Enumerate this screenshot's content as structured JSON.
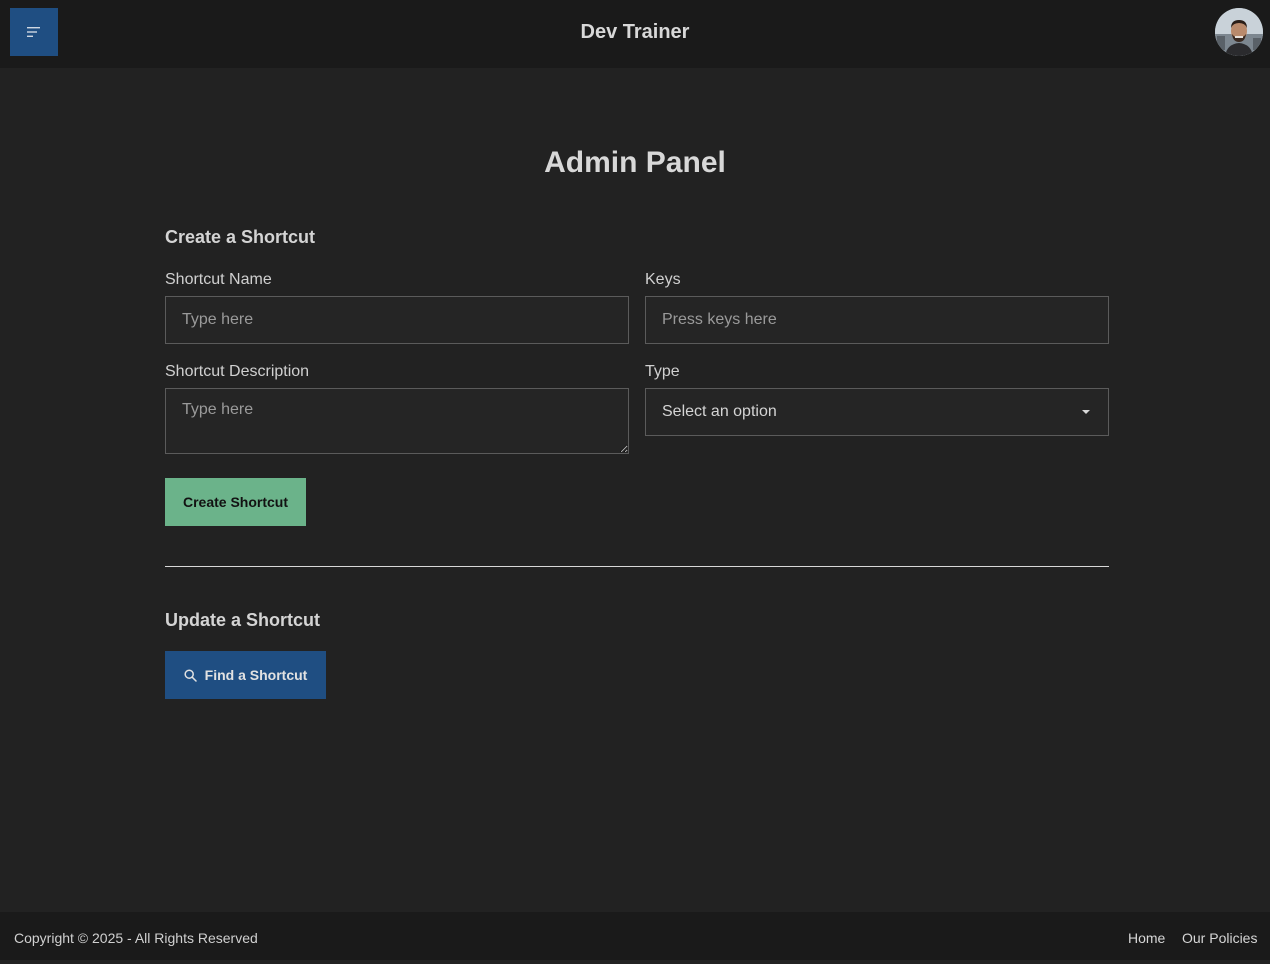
{
  "header": {
    "title": "Dev Trainer",
    "menu_icon": "menu-icon",
    "avatar_icon": "user-avatar"
  },
  "page": {
    "title": "Admin Panel"
  },
  "create_section": {
    "title": "Create a Shortcut",
    "name_label": "Shortcut Name",
    "name_placeholder": "Type here",
    "keys_label": "Keys",
    "keys_placeholder": "Press keys here",
    "description_label": "Shortcut Description",
    "description_placeholder": "Type here",
    "type_label": "Type",
    "type_value": "Select an option",
    "submit_label": "Create Shortcut"
  },
  "update_section": {
    "title": "Update a Shortcut",
    "find_label": "Find a Shortcut",
    "find_icon": "search-icon"
  },
  "footer": {
    "copyright": "Copyright © 2025 - All Rights Reserved",
    "links": [
      {
        "label": "Home"
      },
      {
        "label": "Our Policies"
      }
    ]
  },
  "colors": {
    "background": "#222222",
    "header_bg": "#1a1a1a",
    "primary": "#1f4e82",
    "success": "#6bb38a"
  }
}
